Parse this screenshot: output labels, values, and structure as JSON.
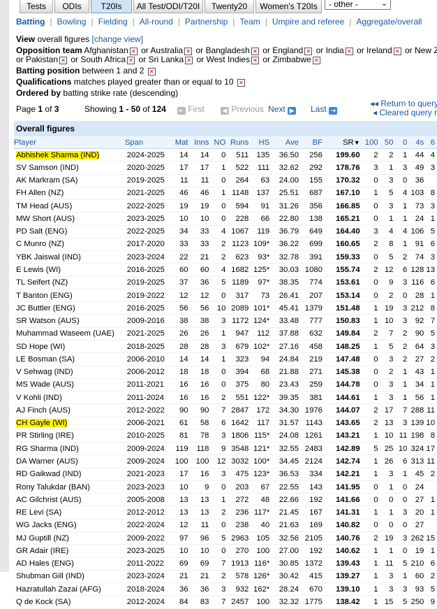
{
  "tabs": [
    "Tests",
    "ODIs",
    "T20Is",
    "All Test/ODI/T20I",
    "Twenty20",
    "Women's T20Is"
  ],
  "tab_active": "T20Is",
  "other_select": "- other -",
  "subnav": [
    "Batting",
    "Bowling",
    "Fielding",
    "All-round",
    "Partnership",
    "Team",
    "Umpire and referee",
    "Aggregate/overall"
  ],
  "view": {
    "label": "View",
    "value": "overall figures",
    "change": "[change view]"
  },
  "opposition": {
    "label": "Opposition team",
    "line1": [
      "Afghanistan",
      "or Australia",
      "or Bangladesh",
      "or England",
      "or India",
      "or Ireland",
      "or New Zeala"
    ],
    "line2": [
      "or Pakistan",
      "or South Africa",
      "or Sri Lanka",
      "or West Indies",
      "or Zimbabwe"
    ]
  },
  "batting_position": {
    "label": "Batting position",
    "value": "between 1 and 2"
  },
  "qualifications": {
    "label": "Qualifications",
    "value": "matches played greater than or equal to 10"
  },
  "ordered": {
    "label": "Ordered by",
    "value": "batting strike rate (descending)"
  },
  "pager": {
    "page_prefix": "Page",
    "page": "1",
    "of": "of",
    "pages": "3",
    "showing_prefix": "Showing",
    "range": "1 - 50",
    "total": "124",
    "first": "First",
    "previous": "Previous",
    "next": "Next",
    "last": "Last"
  },
  "return_query": "Return to query m",
  "cleared_query": "Cleared query m",
  "table": {
    "caption": "Overall figures",
    "columns": [
      "Player",
      "Span",
      "Mat",
      "Inns",
      "NO",
      "Runs",
      "HS",
      "Ave",
      "BF",
      "SR",
      "100",
      "50",
      "0",
      "4s",
      "6"
    ],
    "sort_marker": "▼",
    "rows": [
      [
        "Abhishek Sharma (IND)",
        "2024-2025",
        "14",
        "14",
        "0",
        "511",
        "135",
        "36.50",
        "256",
        "199.60",
        "2",
        "2",
        "1",
        "44",
        "4"
      ],
      [
        "SV Samson (IND)",
        "2020-2025",
        "17",
        "17",
        "1",
        "522",
        "111",
        "32.62",
        "292",
        "178.76",
        "3",
        "1",
        "3",
        "49",
        "3"
      ],
      [
        "AK Markram (SA)",
        "2019-2025",
        "11",
        "11",
        "0",
        "264",
        "63",
        "24.00",
        "155",
        "170.32",
        "0",
        "3",
        "0",
        "36",
        ""
      ],
      [
        "FH Allen (NZ)",
        "2021-2025",
        "46",
        "46",
        "1",
        "1148",
        "137",
        "25.51",
        "687",
        "167.10",
        "1",
        "5",
        "4",
        "103",
        "8"
      ],
      [
        "TM Head (AUS)",
        "2022-2025",
        "19",
        "19",
        "0",
        "594",
        "91",
        "31.26",
        "356",
        "166.85",
        "0",
        "3",
        "1",
        "73",
        "3"
      ],
      [
        "MW Short (AUS)",
        "2023-2025",
        "10",
        "10",
        "0",
        "228",
        "66",
        "22.80",
        "138",
        "165.21",
        "0",
        "1",
        "1",
        "24",
        "1"
      ],
      [
        "PD Salt (ENG)",
        "2022-2025",
        "34",
        "33",
        "4",
        "1067",
        "119",
        "36.79",
        "649",
        "164.40",
        "3",
        "4",
        "4",
        "106",
        "5"
      ],
      [
        "C Munro (NZ)",
        "2017-2020",
        "33",
        "33",
        "2",
        "1123",
        "109*",
        "36.22",
        "699",
        "160.65",
        "2",
        "8",
        "1",
        "91",
        "6"
      ],
      [
        "YBK Jaiswal (IND)",
        "2023-2024",
        "22",
        "21",
        "2",
        "623",
        "93*",
        "32.78",
        "391",
        "159.33",
        "0",
        "5",
        "2",
        "74",
        "3"
      ],
      [
        "E Lewis (WI)",
        "2016-2025",
        "60",
        "60",
        "4",
        "1682",
        "125*",
        "30.03",
        "1080",
        "155.74",
        "2",
        "12",
        "6",
        "128",
        "13"
      ],
      [
        "TL Seifert (NZ)",
        "2019-2025",
        "37",
        "36",
        "5",
        "1189",
        "97*",
        "38.35",
        "774",
        "153.61",
        "0",
        "9",
        "3",
        "116",
        "6"
      ],
      [
        "T Banton (ENG)",
        "2019-2022",
        "12",
        "12",
        "0",
        "317",
        "73",
        "26.41",
        "207",
        "153.14",
        "0",
        "2",
        "0",
        "28",
        "1"
      ],
      [
        "JC Buttler (ENG)",
        "2016-2025",
        "56",
        "56",
        "10",
        "2089",
        "101*",
        "45.41",
        "1379",
        "151.48",
        "1",
        "19",
        "3",
        "212",
        "8"
      ],
      [
        "SR Watson (AUS)",
        "2009-2016",
        "38",
        "38",
        "3",
        "1172",
        "124*",
        "33.48",
        "777",
        "150.83",
        "1",
        "10",
        "3",
        "92",
        "7"
      ],
      [
        "Muhammad Waseem (UAE)",
        "2021-2025",
        "26",
        "26",
        "1",
        "947",
        "112",
        "37.88",
        "632",
        "149.84",
        "2",
        "7",
        "2",
        "90",
        "5"
      ],
      [
        "SD Hope (WI)",
        "2018-2025",
        "28",
        "28",
        "3",
        "679",
        "102*",
        "27.16",
        "458",
        "148.25",
        "1",
        "5",
        "2",
        "64",
        "3"
      ],
      [
        "LE Bosman (SA)",
        "2006-2010",
        "14",
        "14",
        "1",
        "323",
        "94",
        "24.84",
        "219",
        "147.48",
        "0",
        "3",
        "2",
        "27",
        "2"
      ],
      [
        "V Sehwag (IND)",
        "2006-2012",
        "18",
        "18",
        "0",
        "394",
        "68",
        "21.88",
        "271",
        "145.38",
        "0",
        "2",
        "1",
        "43",
        "1"
      ],
      [
        "MS Wade (AUS)",
        "2011-2021",
        "16",
        "16",
        "0",
        "375",
        "80",
        "23.43",
        "259",
        "144.78",
        "0",
        "3",
        "1",
        "34",
        "1"
      ],
      [
        "V Kohli (IND)",
        "2011-2024",
        "16",
        "16",
        "2",
        "551",
        "122*",
        "39.35",
        "381",
        "144.61",
        "1",
        "3",
        "1",
        "56",
        "1"
      ],
      [
        "AJ Finch (AUS)",
        "2012-2022",
        "90",
        "90",
        "7",
        "2847",
        "172",
        "34.30",
        "1976",
        "144.07",
        "2",
        "17",
        "7",
        "288",
        "11"
      ],
      [
        "CH Gayle (WI)",
        "2006-2021",
        "61",
        "58",
        "6",
        "1642",
        "117",
        "31.57",
        "1143",
        "143.65",
        "2",
        "13",
        "3",
        "139",
        "10"
      ],
      [
        "PR Stirling (IRE)",
        "2010-2025",
        "81",
        "78",
        "3",
        "1806",
        "115*",
        "24.08",
        "1261",
        "143.21",
        "1",
        "10",
        "11",
        "198",
        "8"
      ],
      [
        "RG Sharma (IND)",
        "2009-2024",
        "119",
        "118",
        "9",
        "3548",
        "121*",
        "32.55",
        "2483",
        "142.89",
        "5",
        "25",
        "10",
        "324",
        "17"
      ],
      [
        "DA Warner (AUS)",
        "2009-2024",
        "100",
        "100",
        "12",
        "3032",
        "100*",
        "34.45",
        "2124",
        "142.74",
        "1",
        "26",
        "6",
        "313",
        "11"
      ],
      [
        "RD Gaikwad (IND)",
        "2021-2023",
        "17",
        "16",
        "3",
        "475",
        "123*",
        "36.53",
        "334",
        "142.21",
        "1",
        "3",
        "1",
        "45",
        "2"
      ],
      [
        "Rony Talukdar (BAN)",
        "2023-2023",
        "10",
        "9",
        "0",
        "203",
        "67",
        "22.55",
        "143",
        "141.95",
        "0",
        "1",
        "0",
        "24",
        ""
      ],
      [
        "AC Gilchrist (AUS)",
        "2005-2008",
        "13",
        "13",
        "1",
        "272",
        "48",
        "22.66",
        "192",
        "141.66",
        "0",
        "0",
        "0",
        "27",
        "1"
      ],
      [
        "RE Levi (SA)",
        "2012-2012",
        "13",
        "13",
        "2",
        "236",
        "117*",
        "21.45",
        "167",
        "141.31",
        "1",
        "1",
        "3",
        "20",
        "1"
      ],
      [
        "WG Jacks (ENG)",
        "2022-2024",
        "12",
        "11",
        "0",
        "238",
        "40",
        "21.63",
        "169",
        "140.82",
        "0",
        "0",
        "0",
        "27",
        ""
      ],
      [
        "MJ Guptill (NZ)",
        "2009-2022",
        "97",
        "96",
        "5",
        "2963",
        "105",
        "32.56",
        "2105",
        "140.76",
        "2",
        "19",
        "3",
        "262",
        "15"
      ],
      [
        "GR Adair (IRE)",
        "2023-2025",
        "10",
        "10",
        "0",
        "270",
        "100",
        "27.00",
        "192",
        "140.62",
        "1",
        "1",
        "0",
        "19",
        "1"
      ],
      [
        "AD Hales (ENG)",
        "2011-2022",
        "69",
        "69",
        "7",
        "1913",
        "116*",
        "30.85",
        "1372",
        "139.43",
        "1",
        "11",
        "5",
        "210",
        "6"
      ],
      [
        "Shubman Gill (IND)",
        "2023-2024",
        "21",
        "21",
        "2",
        "578",
        "126*",
        "30.42",
        "415",
        "139.27",
        "1",
        "3",
        "1",
        "60",
        "2"
      ],
      [
        "Hazratullah Zazai (AFG)",
        "2018-2024",
        "36",
        "36",
        "3",
        "932",
        "162*",
        "28.24",
        "670",
        "139.10",
        "1",
        "3",
        "3",
        "93",
        "5"
      ],
      [
        "Q de Kock (SA)",
        "2012-2024",
        "84",
        "83",
        "7",
        "2457",
        "100",
        "32.32",
        "1775",
        "138.42",
        "1",
        "15",
        "5",
        "250",
        "9"
      ]
    ],
    "highlighted_players": [
      "Abhishek Sharma (IND)",
      "CH Gayle (WI)"
    ]
  }
}
